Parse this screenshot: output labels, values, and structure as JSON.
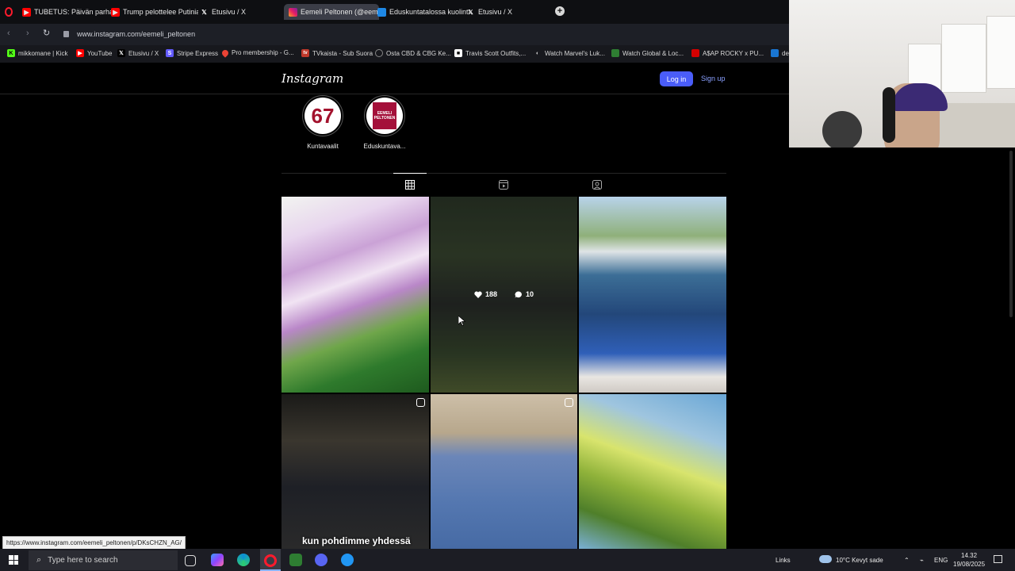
{
  "browser": {
    "tabs": [
      {
        "label": "TUBETUS: Päivän parhaat",
        "icon": "youtube-icon",
        "active": false
      },
      {
        "label": "Trump pelottelee Putinia",
        "icon": "youtube-icon",
        "active": false
      },
      {
        "label": "Etusivu / X",
        "icon": "x-icon",
        "active": false
      },
      {
        "label": "Eemeli Peltonen (@eeme",
        "icon": "instagram-icon",
        "active": true
      },
      {
        "label": "Eduskuntatalossa kuolinta",
        "icon": "news-icon",
        "active": false
      },
      {
        "label": "Etusivu / X",
        "icon": "x-icon",
        "active": false
      }
    ],
    "new_tab": "+",
    "url": "www.instagram.com/eemeli_peltonen",
    "bookmarks": [
      {
        "label": "mikkomane | Kick",
        "color": "#53fc18"
      },
      {
        "label": "YouTube",
        "color": "#ff0000"
      },
      {
        "label": "Etusivu / X",
        "color": "#000000"
      },
      {
        "label": "Stripe Express",
        "color": "#635bff"
      },
      {
        "label": "Pro membership - G...",
        "color": "#ea4335"
      },
      {
        "label": "TVkaista - Sub Suora",
        "color": "#c0392b"
      },
      {
        "label": "Osta CBD & CBG Ke...",
        "color": "#555555"
      },
      {
        "label": "Travis Scott Outfits,...",
        "color": "#ffffff"
      },
      {
        "label": "Watch Marvel's Luk...",
        "color": "#cccccc"
      },
      {
        "label": "Watch Global & Loc...",
        "color": "#2e7d32"
      },
      {
        "label": "A$AP ROCKY x PU...",
        "color": "#d50000"
      },
      {
        "label": "de",
        "color": "#1976d2"
      }
    ]
  },
  "instagram": {
    "logo": "Instagram",
    "login_label": "Log in",
    "signup_label": "Sign up",
    "highlights": [
      {
        "label": "Kuntavaalit",
        "cover_text": "67"
      },
      {
        "label": "Eduskuntava...",
        "cover_text": "EEMELI PELTONEN"
      }
    ],
    "hover_stats": {
      "likes": "188",
      "comments": "10"
    },
    "reel_caption": "kun pohdimme yhdessä"
  },
  "status_link": "https://www.instagram.com/eemeli_peltonen/p/DKsCHZN_AG/",
  "taskbar": {
    "search_placeholder": "Type here to search",
    "links_label": "Links",
    "weather": "10°C  Kevyt sade",
    "language": "ENG",
    "time": "14.32",
    "date": "19/08/2025"
  }
}
